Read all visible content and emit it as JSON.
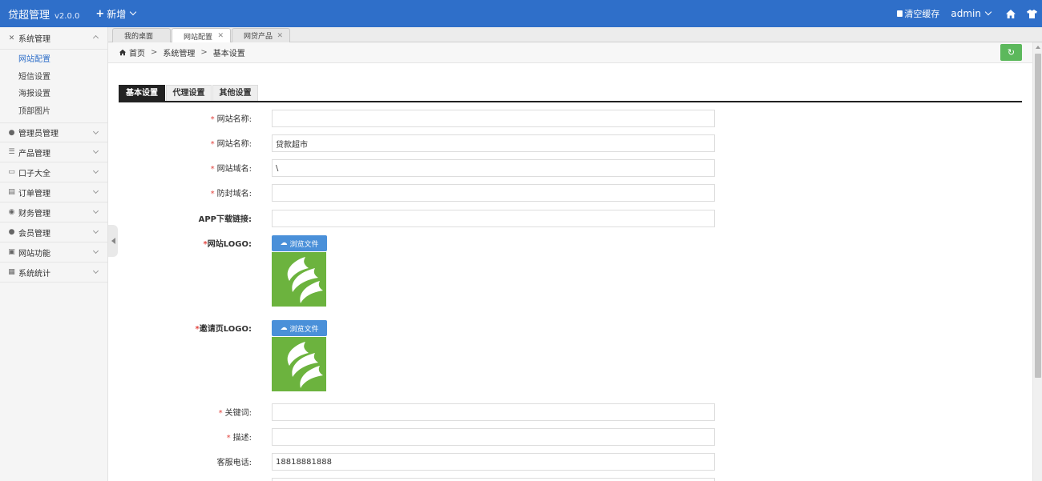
{
  "header": {
    "title": "贷超管理",
    "version": "v2.0.0",
    "add_new": "新增",
    "clear_cache": "清空缓存",
    "user": "admin"
  },
  "sidebar": {
    "groups": [
      {
        "label": "系统管理",
        "icon": "wrench-icon",
        "open": true,
        "items": [
          {
            "label": "网站配置",
            "active": true
          },
          {
            "label": "短信设置"
          },
          {
            "label": "海报设置"
          },
          {
            "label": "顶部图片"
          }
        ]
      },
      {
        "label": "管理员管理",
        "icon": "user-icon"
      },
      {
        "label": "产品管理",
        "icon": "list-icon"
      },
      {
        "label": "口子大全",
        "icon": "monitor-icon"
      },
      {
        "label": "订单管理",
        "icon": "order-icon"
      },
      {
        "label": "财务管理",
        "icon": "finance-icon"
      },
      {
        "label": "会员管理",
        "icon": "member-icon"
      },
      {
        "label": "网站功能",
        "icon": "image-icon"
      },
      {
        "label": "系统统计",
        "icon": "chart-icon"
      }
    ]
  },
  "page_tabs": [
    {
      "label": "我的桌面"
    },
    {
      "label": "网站配置",
      "active": true
    },
    {
      "label": "网贷产品"
    }
  ],
  "breadcrumb": {
    "home": "首页",
    "level1": "系统管理",
    "level2": "基本设置"
  },
  "content_tabs": [
    {
      "label": "基本设置",
      "active": true
    },
    {
      "label": "代理设置"
    },
    {
      "label": "其他设置"
    }
  ],
  "form": {
    "site_name_1": {
      "label": "网站名称:",
      "value": ""
    },
    "site_name_2": {
      "label": "网站名称:",
      "value": "贷款超市"
    },
    "domain": {
      "label": "网站域名:",
      "value": "\\"
    },
    "block_domain": {
      "label": "防封域名:",
      "value": ""
    },
    "app_link": {
      "label": "APP下载链接:",
      "value": ""
    },
    "site_logo": {
      "label": "网站LOGO:",
      "button": "浏览文件"
    },
    "invite_logo": {
      "label": "邀请页LOGO:",
      "button": "浏览文件"
    },
    "keywords": {
      "label": "关键词:",
      "value": ""
    },
    "description": {
      "label": "描述:",
      "value": ""
    },
    "phone": {
      "label": "客服电话:",
      "value": "18818881888"
    }
  },
  "colors": {
    "header": "#2f6fc9",
    "refresh": "#5cb85c",
    "upload": "#4a90d9",
    "logo_bg": "#6cb33e",
    "required": "#e2453f"
  }
}
